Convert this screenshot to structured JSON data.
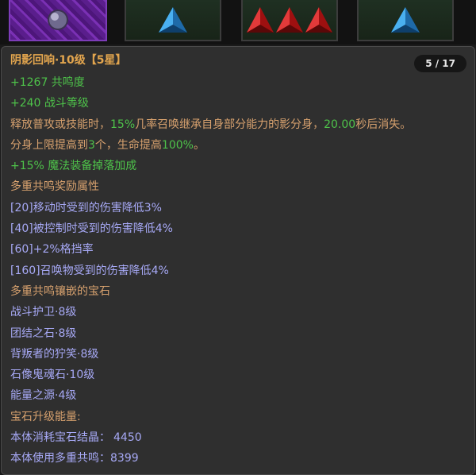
{
  "slots": [
    {
      "name": "purple-orb-gem",
      "icon": "orb-icon",
      "color": "#7a30b4"
    },
    {
      "name": "blue-gem",
      "icon": "blue-triangle-gem-icon",
      "color": "#2f8fd6"
    },
    {
      "name": "red-gems",
      "icon": "red-triangle-gem-icon",
      "color": "#c41a1a"
    },
    {
      "name": "blue-gem-2",
      "icon": "blue-triangle-gem-icon",
      "color": "#2f8fd6"
    }
  ],
  "tooltip": {
    "title": "阴影回响·10级【5星】",
    "counter": "5 / 17",
    "resonance": "+1267 共鸣度",
    "combat_level": "+240 战斗等级",
    "desc1": {
      "a": "释放普攻或技能时，",
      "b": "15%",
      "c": "几率召唤继承自身部分能力的影分身，",
      "d": "20.00",
      "e": "秒后消失。"
    },
    "desc2": {
      "a": "分身上限提高到",
      "b": "3",
      "c": "个，生命提高",
      "d": "100%",
      "e": "。"
    },
    "magic_drop": "+15% 魔法装备掉落加成",
    "bonus_header": "多重共鸣奖励属性",
    "bonuses": [
      "[20]移动时受到的伤害降低3%",
      "[40]被控制时受到的伤害降低4%",
      "[60]+2%格挡率",
      "[160]召唤物受到的伤害降低4%"
    ],
    "gems_header": "多重共鸣镶嵌的宝石",
    "gems": [
      "战斗护卫·8级",
      "团结之石·8级",
      "背叛者的狞笑·8级",
      "石像鬼魂石·10级",
      "能量之源·4级"
    ],
    "upgrade_header": "宝石升级能量:",
    "consume_label": "本体消耗宝石结晶：",
    "consume_value": "4450",
    "use_label": "本体使用多重共鸣：",
    "use_value": "8399"
  }
}
